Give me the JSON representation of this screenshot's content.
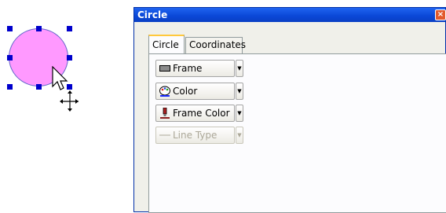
{
  "window": {
    "title": "Circle",
    "close_glyph": "×"
  },
  "tabs": [
    {
      "label": "Circle",
      "active": true
    },
    {
      "label": "Coordinates",
      "active": false
    }
  ],
  "controls": [
    {
      "label": "Frame",
      "icon": "frame-icon",
      "enabled": true
    },
    {
      "label": "Color",
      "icon": "palette-icon",
      "enabled": true
    },
    {
      "label": "Frame Color",
      "icon": "brush-icon",
      "enabled": true
    },
    {
      "label": "Line Type",
      "icon": "line-icon",
      "enabled": false
    }
  ],
  "colors": {
    "circle_fill": "#ff99ff",
    "selection_handle": "#0000cc",
    "title_bar": "#0a47d6",
    "tab_highlight": "#ffc83c"
  }
}
